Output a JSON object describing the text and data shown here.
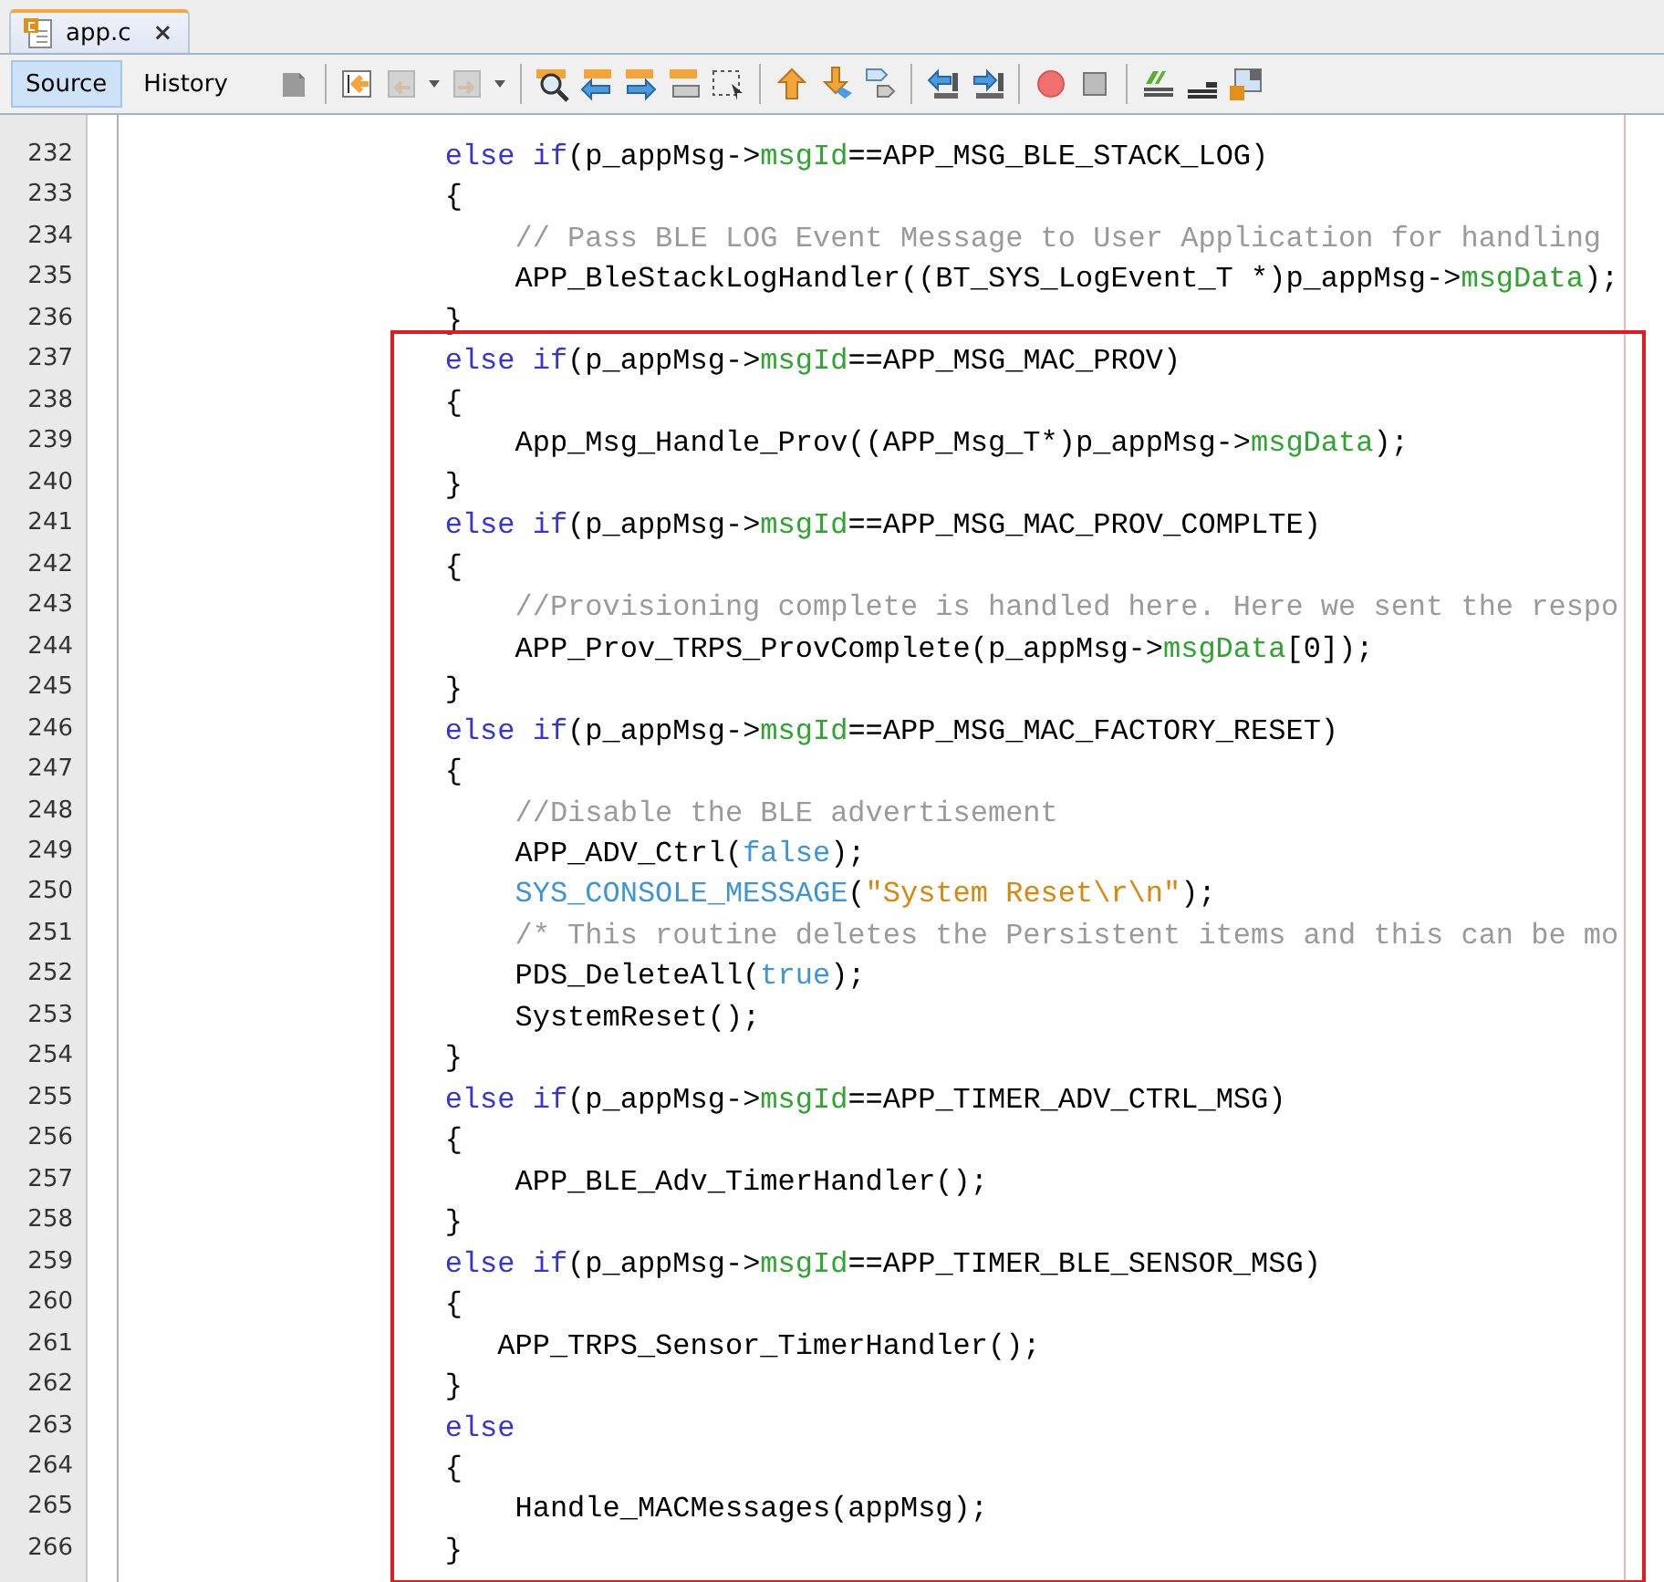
{
  "tabs": [
    {
      "label": "app.c",
      "close": "×",
      "selected": true
    }
  ],
  "view_buttons": [
    {
      "label": "Source",
      "selected": true
    },
    {
      "label": "History",
      "selected": false
    }
  ],
  "lines": [
    {
      "number": "232",
      "tokens": [
        {
          "kind": "keyword",
          "text": "                  else if"
        },
        {
          "kind": "plain",
          "text": "(p_appMsg->"
        },
        {
          "kind": "field",
          "text": "msgId"
        },
        {
          "kind": "plain",
          "text": "==APP_MSG_BLE_STACK_LOG)"
        }
      ]
    },
    {
      "number": "233",
      "tokens": [
        {
          "kind": "plain",
          "text": "                  {"
        }
      ]
    },
    {
      "number": "234",
      "tokens": [
        {
          "kind": "comment",
          "text": "                      // Pass BLE LOG Event Message to User Application for handling"
        }
      ]
    },
    {
      "number": "235",
      "tokens": [
        {
          "kind": "plain",
          "text": "                      APP_BleStackLogHandler((BT_SYS_LogEvent_T *)p_appMsg->"
        },
        {
          "kind": "field",
          "text": "msgData"
        },
        {
          "kind": "plain",
          "text": ");"
        }
      ]
    },
    {
      "number": "236",
      "tokens": [
        {
          "kind": "plain",
          "text": "                  }"
        }
      ]
    },
    {
      "number": "237",
      "tokens": [
        {
          "kind": "keyword",
          "text": "                  else if"
        },
        {
          "kind": "plain",
          "text": "(p_appMsg->"
        },
        {
          "kind": "field",
          "text": "msgId"
        },
        {
          "kind": "plain",
          "text": "==APP_MSG_MAC_PROV)"
        }
      ]
    },
    {
      "number": "238",
      "tokens": [
        {
          "kind": "plain",
          "text": "                  {"
        }
      ]
    },
    {
      "number": "239",
      "tokens": [
        {
          "kind": "plain",
          "text": "                      App_Msg_Handle_Prov((APP_Msg_T*)p_appMsg->"
        },
        {
          "kind": "field",
          "text": "msgData"
        },
        {
          "kind": "plain",
          "text": ");"
        }
      ]
    },
    {
      "number": "240",
      "tokens": [
        {
          "kind": "plain",
          "text": "                  }"
        }
      ]
    },
    {
      "number": "241",
      "tokens": [
        {
          "kind": "keyword",
          "text": "                  else if"
        },
        {
          "kind": "plain",
          "text": "(p_appMsg->"
        },
        {
          "kind": "field",
          "text": "msgId"
        },
        {
          "kind": "plain",
          "text": "==APP_MSG_MAC_PROV_COMPLTE)"
        }
      ]
    },
    {
      "number": "242",
      "tokens": [
        {
          "kind": "plain",
          "text": "                  {"
        }
      ]
    },
    {
      "number": "243",
      "tokens": [
        {
          "kind": "comment",
          "text": "                      //Provisioning complete is handled here. Here we sent the respo"
        }
      ]
    },
    {
      "number": "244",
      "tokens": [
        {
          "kind": "plain",
          "text": "                      APP_Prov_TRPS_ProvComplete(p_appMsg->"
        },
        {
          "kind": "field",
          "text": "msgData"
        },
        {
          "kind": "plain",
          "text": "[0]);"
        }
      ]
    },
    {
      "number": "245",
      "tokens": [
        {
          "kind": "plain",
          "text": "                  }"
        }
      ]
    },
    {
      "number": "246",
      "tokens": [
        {
          "kind": "keyword",
          "text": "                  else if"
        },
        {
          "kind": "plain",
          "text": "(p_appMsg->"
        },
        {
          "kind": "field",
          "text": "msgId"
        },
        {
          "kind": "plain",
          "text": "==APP_MSG_MAC_FACTORY_RESET)"
        }
      ]
    },
    {
      "number": "247",
      "tokens": [
        {
          "kind": "plain",
          "text": "                  {"
        }
      ]
    },
    {
      "number": "248",
      "tokens": [
        {
          "kind": "comment",
          "text": "                      //Disable the BLE advertisement"
        }
      ]
    },
    {
      "number": "249",
      "tokens": [
        {
          "kind": "plain",
          "text": "                      APP_ADV_Ctrl("
        },
        {
          "kind": "literal",
          "text": "false"
        },
        {
          "kind": "plain",
          "text": ");"
        }
      ]
    },
    {
      "number": "250",
      "tokens": [
        {
          "kind": "macro",
          "text": "                      SYS_CONSOLE_MESSAGE"
        },
        {
          "kind": "plain",
          "text": "("
        },
        {
          "kind": "string",
          "text": "\"System Reset\\r\\n\""
        },
        {
          "kind": "plain",
          "text": ");"
        }
      ]
    },
    {
      "number": "251",
      "tokens": [
        {
          "kind": "comment",
          "text": "                      /* This routine deletes the Persistent items and this can be mo"
        }
      ]
    },
    {
      "number": "252",
      "tokens": [
        {
          "kind": "plain",
          "text": "                      PDS_DeleteAll("
        },
        {
          "kind": "literal",
          "text": "true"
        },
        {
          "kind": "plain",
          "text": ");"
        }
      ]
    },
    {
      "number": "253",
      "tokens": [
        {
          "kind": "plain",
          "text": "                      SystemReset();"
        }
      ]
    },
    {
      "number": "254",
      "tokens": [
        {
          "kind": "plain",
          "text": "                  }"
        }
      ]
    },
    {
      "number": "255",
      "tokens": [
        {
          "kind": "keyword",
          "text": "                  else if"
        },
        {
          "kind": "plain",
          "text": "(p_appMsg->"
        },
        {
          "kind": "field",
          "text": "msgId"
        },
        {
          "kind": "plain",
          "text": "==APP_TIMER_ADV_CTRL_MSG)"
        }
      ]
    },
    {
      "number": "256",
      "tokens": [
        {
          "kind": "plain",
          "text": "                  {"
        }
      ]
    },
    {
      "number": "257",
      "tokens": [
        {
          "kind": "plain",
          "text": "                      APP_BLE_Adv_TimerHandler();"
        }
      ]
    },
    {
      "number": "258",
      "tokens": [
        {
          "kind": "plain",
          "text": "                  }"
        }
      ]
    },
    {
      "number": "259",
      "tokens": [
        {
          "kind": "keyword",
          "text": "                  else if"
        },
        {
          "kind": "plain",
          "text": "(p_appMsg->"
        },
        {
          "kind": "field",
          "text": "msgId"
        },
        {
          "kind": "plain",
          "text": "==APP_TIMER_BLE_SENSOR_MSG)"
        }
      ]
    },
    {
      "number": "260",
      "tokens": [
        {
          "kind": "plain",
          "text": "                  {"
        }
      ]
    },
    {
      "number": "261",
      "tokens": [
        {
          "kind": "plain",
          "text": "                     APP_TRPS_Sensor_TimerHandler();"
        }
      ]
    },
    {
      "number": "262",
      "tokens": [
        {
          "kind": "plain",
          "text": "                  }"
        }
      ]
    },
    {
      "number": "263",
      "tokens": [
        {
          "kind": "keyword",
          "text": "                  else"
        }
      ]
    },
    {
      "number": "264",
      "tokens": [
        {
          "kind": "plain",
          "text": "                  {"
        }
      ]
    },
    {
      "number": "265",
      "tokens": [
        {
          "kind": "plain",
          "text": "                      Handle_MACMessages(appMsg);"
        }
      ]
    },
    {
      "number": "266",
      "tokens": [
        {
          "kind": "plain",
          "text": "                  }"
        }
      ]
    }
  ]
}
